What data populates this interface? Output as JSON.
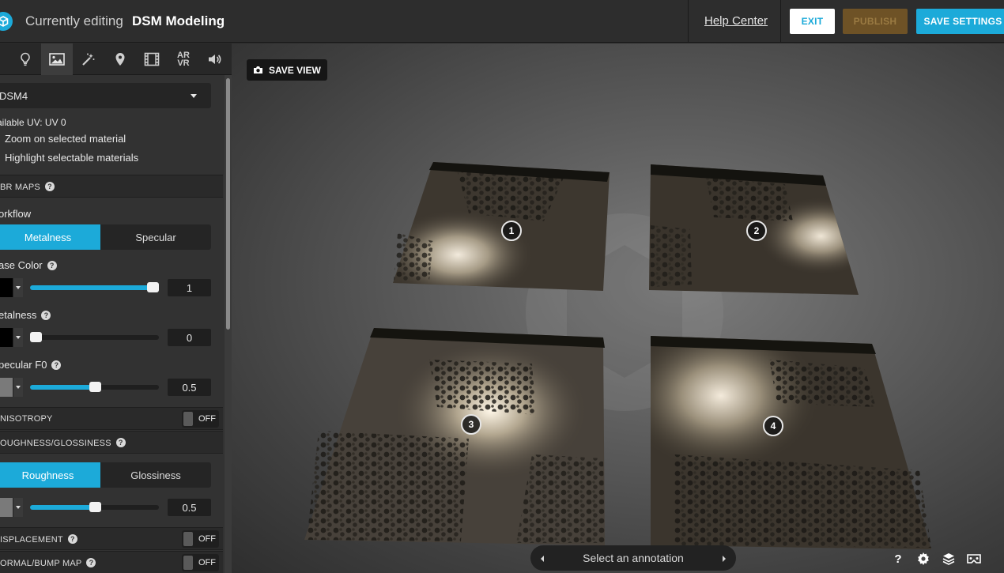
{
  "header": {
    "title_prefix": "Currently editing",
    "model_name": "DSM Modeling",
    "help_link": "Help Center",
    "exit_label": "EXIT",
    "publish_label": "PUBLISH",
    "save_settings_label": "SAVE SETTINGS"
  },
  "tabs": {
    "icons": [
      "lightbulb-icon",
      "image-icon",
      "magic-wand-icon",
      "map-pin-icon",
      "film-icon",
      "ar-vr-icon",
      "speaker-icon"
    ],
    "active": "image-icon",
    "arvr_label_top": "AR",
    "arvr_label_bottom": "VR"
  },
  "materials": {
    "selected": "DSM4",
    "available_uv": "ailable UV: UV 0",
    "zoom_on_selected": "Zoom on selected material",
    "highlight_selectable": "Highlight selectable materials"
  },
  "pbr": {
    "section_title": "BR MAPS",
    "workflow_label": "orkflow",
    "workflow_options": [
      "Metalness",
      "Specular"
    ],
    "workflow_selected": "Metalness",
    "base_color_label": "ase Color",
    "base_color_value": "1",
    "base_color_level": 0.96,
    "metalness_label": "etalness",
    "metalness_value": "0",
    "metalness_level": 0.0,
    "specular_f0_label": "pecular F0",
    "specular_f0_value": "0.5",
    "specular_f0_level": 0.5
  },
  "anisotropy": {
    "label": "NISOTROPY",
    "state": "OFF"
  },
  "roughness": {
    "section_title": "OUGHNESS/GLOSSINESS",
    "options": [
      "Roughness",
      "Glossiness"
    ],
    "selected": "Roughness",
    "value": "0.5",
    "level": 0.5
  },
  "displacement": {
    "label": "ISPLACEMENT",
    "state": "OFF"
  },
  "normal_bump": {
    "label": "ORMAL/BUMP MAP",
    "state": "OFF"
  },
  "viewport": {
    "save_view_label": "SAVE VIEW",
    "annotations": [
      "1",
      "2",
      "3",
      "4"
    ],
    "annotation_nav_label": "Select an annotation",
    "bottom_icons": [
      "help-icon",
      "settings-icon",
      "layers-icon",
      "vr-headset-icon"
    ],
    "help_glyph": "?"
  },
  "colors": {
    "accent": "#1caad9",
    "publish_bg": "#6e5226",
    "panel_bg": "#323232",
    "header_bg": "#2d2d2d"
  }
}
